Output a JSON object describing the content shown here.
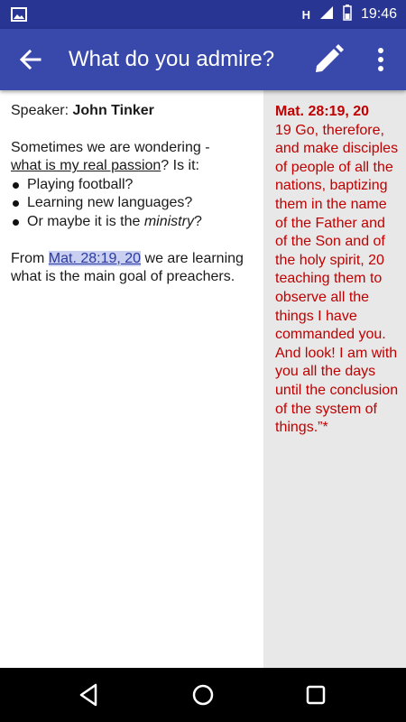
{
  "status_bar": {
    "network_label": "H",
    "time": "19:46"
  },
  "app_bar": {
    "title": "What do you admire?",
    "icons": [
      "arrow-back-icon",
      "pencil-icon",
      "more-vert-icon"
    ]
  },
  "note": {
    "speaker_label": "Speaker:",
    "speaker_name": "John Tinker",
    "intro": "Sometimes we are wondering -",
    "question_underlined": "what is my real passion",
    "question_rest": "? Is it:",
    "bullets": [
      "Playing football?",
      "Learning new languages?",
      "Or maybe it is the"
    ],
    "bullet_emphasis": "ministry",
    "bullet_suffix": "?",
    "from_prefix": "From",
    "reference_link": "Mat. 28:19, 20",
    "from_suffix": "we are learning what is the main goal of preachers."
  },
  "verse_panel": {
    "reference": "Mat. 28:19, 20",
    "text": "19 Go, therefore, and make disciples of people of all the nations, baptizing them in the name of the Father and of the Son and of the holy spirit, 20 teaching them to observe all the things I have commanded you. And look! I am with you all the days until the conclusion of the system of things.”*"
  },
  "colors": {
    "status_bar": "#283593",
    "app_bar": "#3949ab",
    "verse_text": "#c00000",
    "verse_background": "#e8e8e8",
    "link_highlight": "#c9cff0"
  }
}
